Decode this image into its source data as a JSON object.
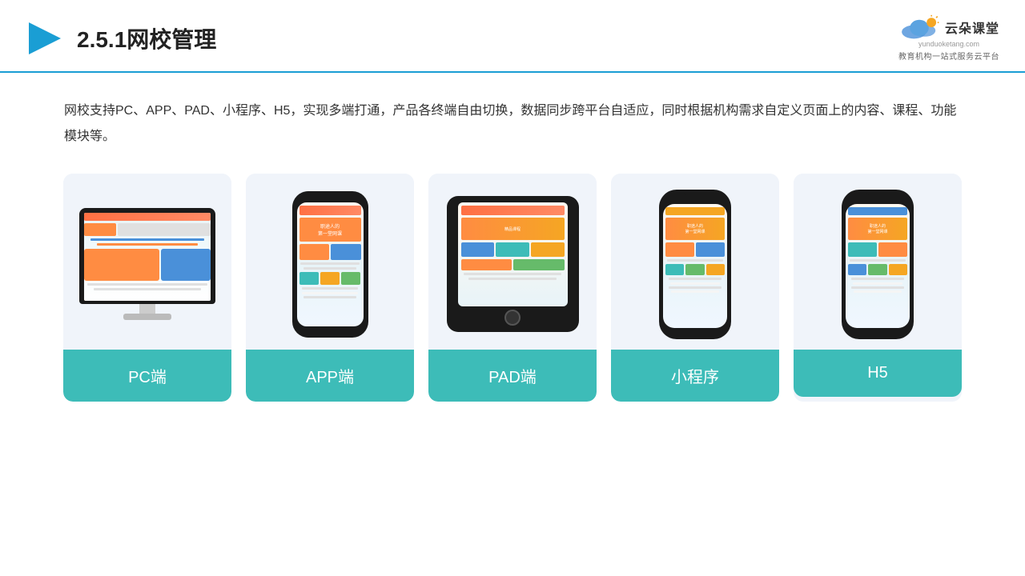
{
  "header": {
    "title_prefix": "2.5.1",
    "title_main": "网校管理",
    "logo_name": "云朵课堂",
    "logo_url": "yunduoketang.com",
    "logo_sub": "教育机构一站\n式服务云平台"
  },
  "description": {
    "text": "网校支持PC、APP、PAD、小程序、H5，实现多端打通，产品各终端自由切换，数据同步跨平台自适应，同时根据机构需求自定义页面上的内容、课程、功能模块等。"
  },
  "cards": [
    {
      "id": "pc",
      "label": "PC端"
    },
    {
      "id": "app",
      "label": "APP端"
    },
    {
      "id": "pad",
      "label": "PAD端"
    },
    {
      "id": "miniprogram",
      "label": "小程序"
    },
    {
      "id": "h5",
      "label": "H5"
    }
  ],
  "colors": {
    "accent": "#3dbcb8",
    "header_line": "#1a9ed4",
    "card_bg": "#f0f4fa",
    "text_dark": "#333333"
  }
}
